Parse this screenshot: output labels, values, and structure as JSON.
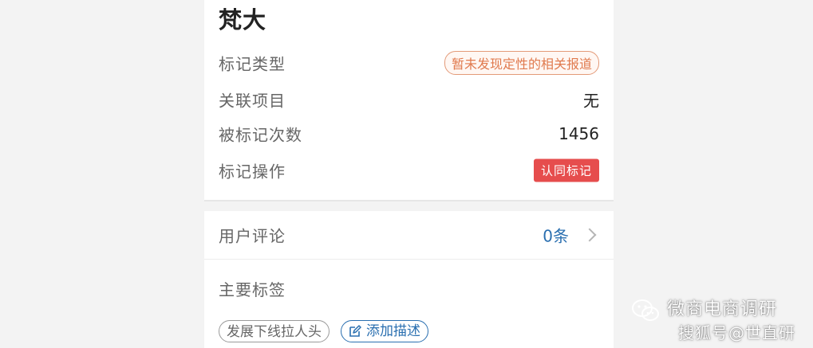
{
  "header": {
    "title": "梵大"
  },
  "details": [
    {
      "label": "标记类型",
      "value": "暂未发现定性的相关报道",
      "kind": "tag"
    },
    {
      "label": "关联项目",
      "value": "无",
      "kind": "text"
    },
    {
      "label": "被标记次数",
      "value": "1456",
      "kind": "text"
    },
    {
      "label": "标记操作",
      "value": "认同标记",
      "kind": "button"
    }
  ],
  "comments": {
    "label": "用户评论",
    "count": "0条"
  },
  "tags_section": {
    "label": "主要标签",
    "tags": [
      "发展下线拉人头"
    ],
    "add_label": "添加描述"
  },
  "watermark": {
    "line1": "微商电商调研",
    "line2": "搜狐号@世直研"
  },
  "colors": {
    "tag_outline": "#e39a78",
    "tag_text": "#e07a4e",
    "button_red": "#e64d4d",
    "link_blue": "#2a6fb0",
    "background": "#f3f3f3"
  }
}
